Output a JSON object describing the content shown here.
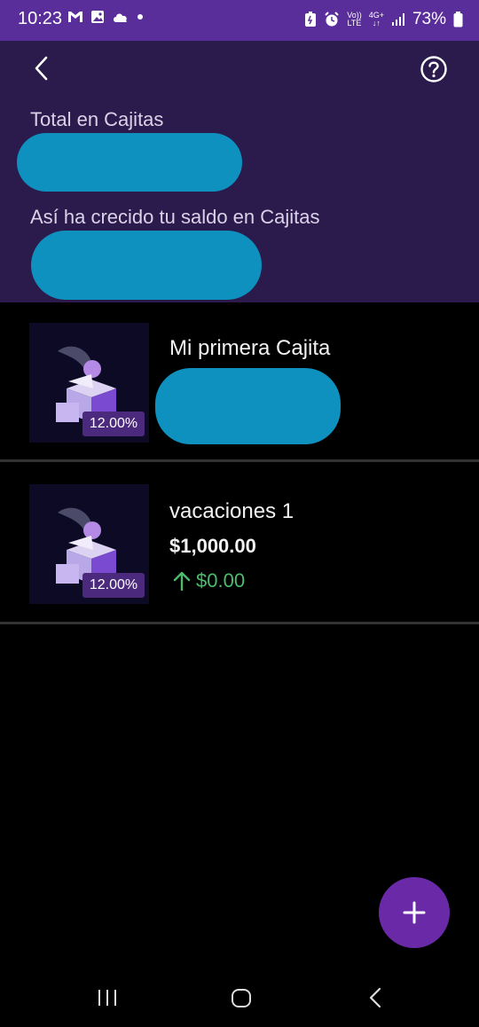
{
  "status_bar": {
    "time": "10:23",
    "volte_top": "Vo))",
    "volte_bottom": "LTE",
    "network": "4G+",
    "battery_percent": "73%"
  },
  "header": {
    "total_label": "Total en Cajitas",
    "growth_label": "Así ha crecido tu saldo en Cajitas"
  },
  "cajitas": [
    {
      "name": "Mi primera Cajita",
      "rate": "12.00%"
    },
    {
      "name": "vacaciones 1",
      "rate": "12.00%",
      "amount": "$1,000.00",
      "growth": "$0.00"
    }
  ],
  "colors": {
    "status_bar": "#5a2e9a",
    "header_bg": "#2a1b4c",
    "redaction": "#0e91bf",
    "fab": "#6a2aa8",
    "growth_green": "#4cbb6b"
  },
  "icons": {
    "back": "chevron-left-icon",
    "help": "question-circle-icon",
    "add": "plus-icon"
  }
}
